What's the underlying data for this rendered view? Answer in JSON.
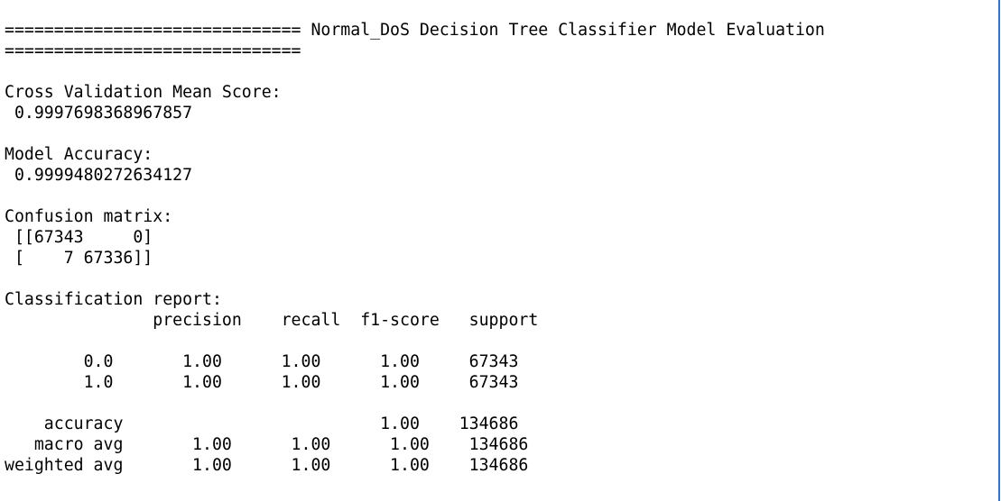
{
  "output": {
    "lines": [
      "============================== Normal_DoS Decision Tree Classifier Model Evaluation",
      "==============================",
      "",
      "Cross Validation Mean Score:",
      " 0.9997698368967857",
      "",
      "Model Accuracy:",
      " 0.9999480272634127",
      "",
      "Confusion matrix:",
      " [[67343     0]",
      " [    7 67336]]",
      "",
      "Classification report:",
      "               precision    recall  f1-score   support",
      "",
      "        0.0       1.00      1.00      1.00     67343",
      "        1.0       1.00      1.00      1.00     67343",
      "",
      "    accuracy                          1.00    134686",
      "   macro avg       1.00      1.00      1.00    134686",
      "weighted avg       1.00      1.00      1.00    134686"
    ]
  },
  "colors": {
    "text": "#000000",
    "background": "#ffffff",
    "window_border": "#2a78d6"
  }
}
